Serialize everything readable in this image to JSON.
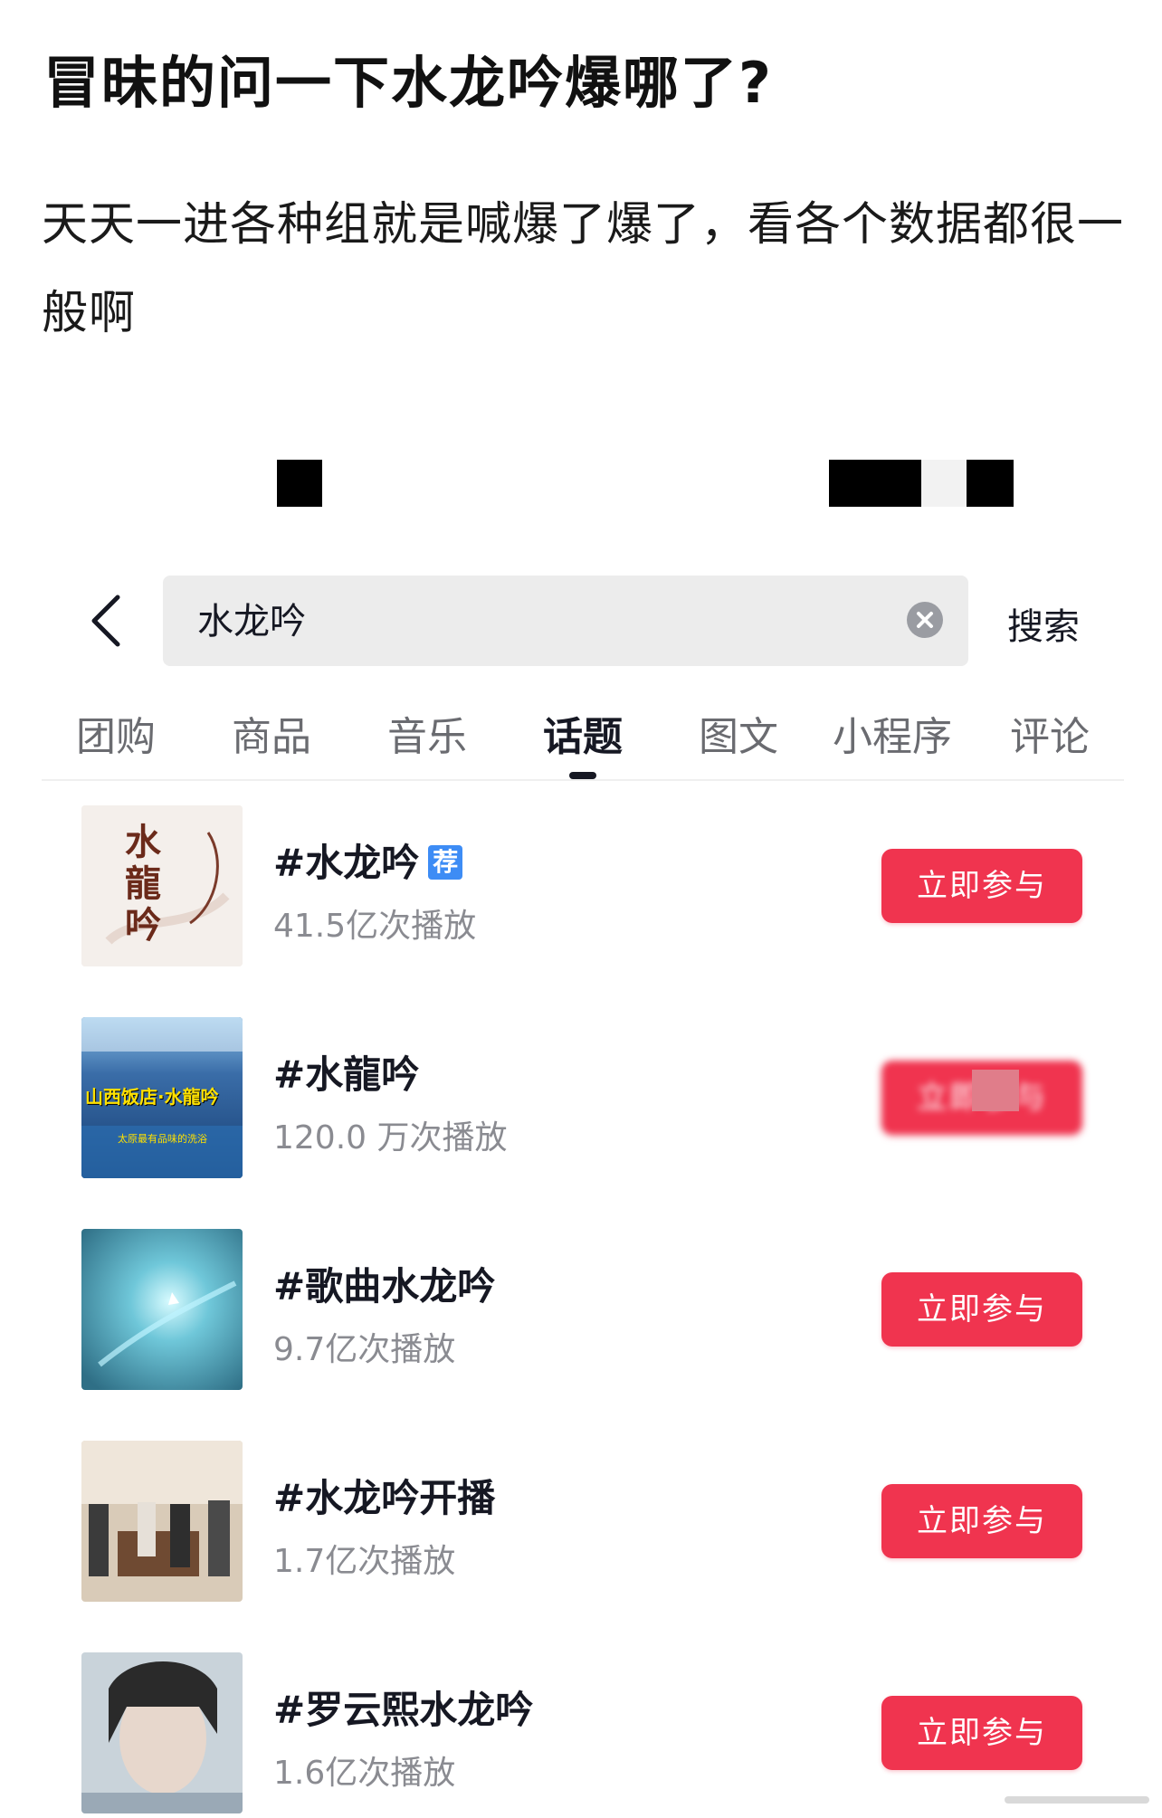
{
  "post": {
    "title": "冒昧的问一下水龙吟爆哪了?",
    "body": "天天一进各种组就是喊爆了爆了，看各个数据都很一般啊"
  },
  "search": {
    "query": "水龙吟",
    "submit_label": "搜索"
  },
  "tabs": [
    {
      "label": "团购",
      "active": false
    },
    {
      "label": "商品",
      "active": false
    },
    {
      "label": "音乐",
      "active": false
    },
    {
      "label": "话题",
      "active": true
    },
    {
      "label": "图文",
      "active": false
    },
    {
      "label": "小程序",
      "active": false
    },
    {
      "label": "评论",
      "active": false
    }
  ],
  "results": [
    {
      "topic": "#水龙吟",
      "badge": "荐",
      "plays": "41.5亿次播放",
      "button": "立即参与",
      "thumb_text": "水龍吟"
    },
    {
      "topic": "#水龍吟",
      "plays": "120.0 万次播放",
      "button": "立即参与",
      "thumb_text": "山西饭店·水龍吟",
      "thumb_subtext": "太原最有品味的洗浴"
    },
    {
      "topic": "#歌曲水龙吟",
      "plays": "9.7亿次播放",
      "button": "立即参与"
    },
    {
      "topic": "#水龙吟开播",
      "plays": "1.7亿次播放",
      "button": "立即参与"
    },
    {
      "topic": "#罗云熙水龙吟",
      "plays": "1.6亿次播放",
      "button": "立即参与"
    }
  ],
  "colors": {
    "accent": "#f0344f",
    "badge": "#3d8cf5",
    "muted_text": "#8a8b91"
  }
}
